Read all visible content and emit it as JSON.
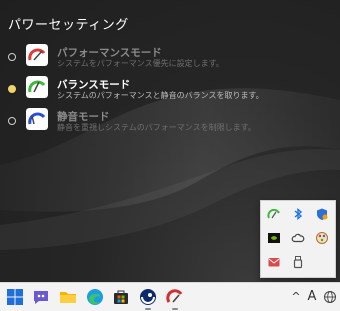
{
  "flyout": {
    "title": "パワーセッティング",
    "modes": [
      {
        "name": "パフォーマンスモード",
        "description": "システムをパフォーマンス優先に設定します。",
        "selected": false,
        "icon": "speedometer-red-icon",
        "color": "#e03a3a"
      },
      {
        "name": "バランスモード",
        "description": "システムのパフォーマンスと静音のバランスを取ります。",
        "selected": true,
        "icon": "speedometer-green-icon",
        "color": "#3fb83f"
      },
      {
        "name": "静音モード",
        "description": "静音を重視しシステムのパフォーマンスを制限します。",
        "selected": false,
        "icon": "speedometer-blue-icon",
        "color": "#2a4fd6"
      }
    ]
  },
  "tray_popup": {
    "icons": [
      "power-gauge-icon",
      "bluetooth-icon",
      "security-shield-icon",
      "nvidia-icon",
      "cloud-icon",
      "settings-palette-icon",
      "mail-icon",
      "usb-drive-icon"
    ]
  },
  "taskbar": {
    "apps": [
      "start-icon",
      "chat-icon",
      "file-explorer-icon",
      "edge-icon",
      "store-icon",
      "cinema4d-icon",
      "power-settings-app-icon"
    ],
    "system": {
      "chevron": "^",
      "ime": "A",
      "language_icon": "globe-icon"
    }
  }
}
